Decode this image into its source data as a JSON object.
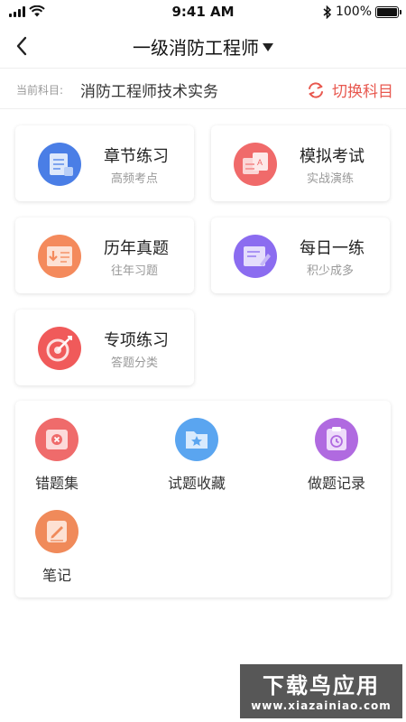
{
  "status_bar": {
    "time": "9:41 AM",
    "battery": "100%",
    "battery_level": 1.0
  },
  "nav": {
    "title": "一级消防工程师"
  },
  "subject": {
    "label": "当前科目:",
    "value": "消防工程师技术实务",
    "switch_label": "切换科目"
  },
  "cards": [
    {
      "name": "章节练习",
      "sub": "高频考点",
      "icon": "chapter-practice-icon",
      "color": "#4a7ee6"
    },
    {
      "name": "模拟考试",
      "sub": "实战演练",
      "icon": "mock-exam-icon",
      "color": "#f06a6a"
    },
    {
      "name": "历年真题",
      "sub": "往年习题",
      "icon": "past-papers-icon",
      "color": "#f48a5c"
    },
    {
      "name": "每日一练",
      "sub": "积少成多",
      "icon": "daily-practice-icon",
      "color": "#8b6cf0"
    },
    {
      "name": "专项练习",
      "sub": "答题分类",
      "icon": "special-practice-icon",
      "color": "#f05a5a"
    }
  ],
  "tools": [
    {
      "label": "错题集",
      "icon": "wrong-questions-icon",
      "color": "#ef6b6b"
    },
    {
      "label": "试题收藏",
      "icon": "favorites-icon",
      "color": "#5aa5f0"
    },
    {
      "label": "做题记录",
      "icon": "history-record-icon",
      "color": "#b06ae0"
    },
    {
      "label": "笔记",
      "icon": "notes-icon",
      "color": "#f08a5a"
    }
  ],
  "watermark": {
    "title": "下载鸟应用",
    "url": "www.xiazainiao.com"
  }
}
